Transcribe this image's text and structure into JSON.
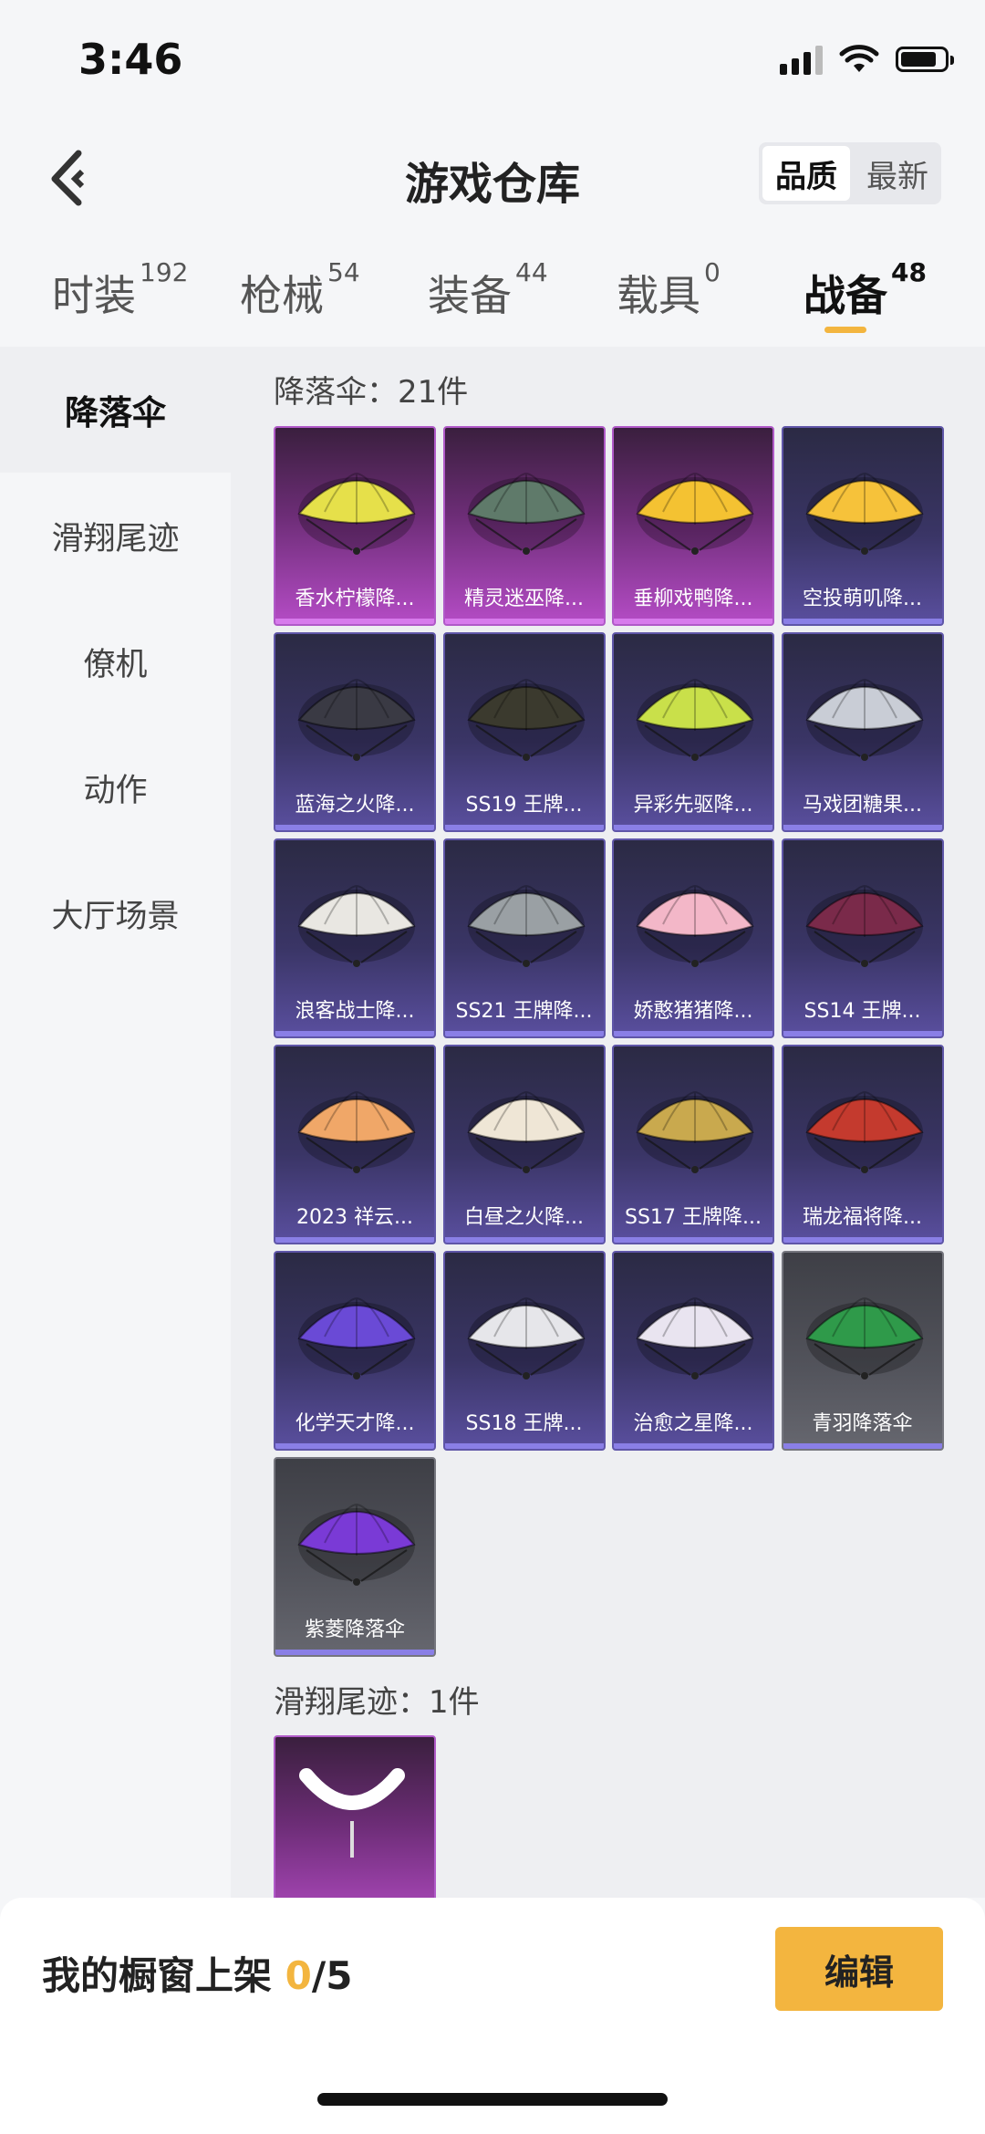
{
  "status": {
    "time": "3:46"
  },
  "header": {
    "title": "游戏仓库",
    "sort": {
      "quality": "品质",
      "newest": "最新"
    }
  },
  "tabs": [
    {
      "label": "时装",
      "count": "192"
    },
    {
      "label": "枪械",
      "count": "54"
    },
    {
      "label": "装备",
      "count": "44"
    },
    {
      "label": "载具",
      "count": "0"
    },
    {
      "label": "战备",
      "count": "48"
    }
  ],
  "sidebar": [
    "降落伞",
    "滑翔尾迹",
    "僚机",
    "动作",
    "大厅场景"
  ],
  "sections": {
    "parachutes": {
      "title": "降落伞：21件",
      "items": [
        {
          "label": "香水柠檬降...",
          "rarity": "pink",
          "color": "#e6e04a"
        },
        {
          "label": "精灵迷巫降...",
          "rarity": "pink",
          "color": "#5f7a6a"
        },
        {
          "label": "垂柳戏鸭降...",
          "rarity": "pink",
          "color": "#f4c232"
        },
        {
          "label": "空投萌叽降...",
          "rarity": "blue",
          "color": "#f6c23a"
        },
        {
          "label": "蓝海之火降...",
          "rarity": "blue",
          "color": "#3a3a44"
        },
        {
          "label": "SS19 王牌...",
          "rarity": "blue",
          "color": "#3b3a2e"
        },
        {
          "label": "异彩先驱降...",
          "rarity": "blue",
          "color": "#c9e04a"
        },
        {
          "label": "马戏团糖果...",
          "rarity": "blue",
          "color": "#c9cdd6"
        },
        {
          "label": "浪客战士降...",
          "rarity": "blue",
          "color": "#e9e7e2"
        },
        {
          "label": "SS21 王牌降...",
          "rarity": "blue",
          "color": "#9aa0a4"
        },
        {
          "label": "娇憨猪猪降...",
          "rarity": "blue",
          "color": "#f3b7c8"
        },
        {
          "label": "SS14 王牌...",
          "rarity": "blue",
          "color": "#7a2a4a"
        },
        {
          "label": "2023 祥云...",
          "rarity": "blue",
          "color": "#f0a768"
        },
        {
          "label": "白昼之火降...",
          "rarity": "blue",
          "color": "#efe6d6"
        },
        {
          "label": "SS17 王牌降...",
          "rarity": "blue",
          "color": "#c9a94e"
        },
        {
          "label": "瑞龙福将降...",
          "rarity": "blue",
          "color": "#c43a2e"
        },
        {
          "label": "化学天才降...",
          "rarity": "blue",
          "color": "#6a4ad6"
        },
        {
          "label": "SS18 王牌...",
          "rarity": "blue",
          "color": "#e6e6ea"
        },
        {
          "label": "治愈之星降...",
          "rarity": "blue",
          "color": "#e9e4f0"
        },
        {
          "label": "青羽降落伞",
          "rarity": "gray",
          "color": "#2f9a4a"
        },
        {
          "label": "紫菱降落伞",
          "rarity": "gray",
          "color": "#7a3ad6"
        }
      ]
    },
    "trails": {
      "title": "滑翔尾迹：1件",
      "items": [
        {
          "label": "",
          "rarity": "pink",
          "color": "#ffffff"
        }
      ]
    }
  },
  "showcase": {
    "label": "我的橱窗上架",
    "current": "0",
    "total": "/5"
  },
  "edit_button": "编辑"
}
